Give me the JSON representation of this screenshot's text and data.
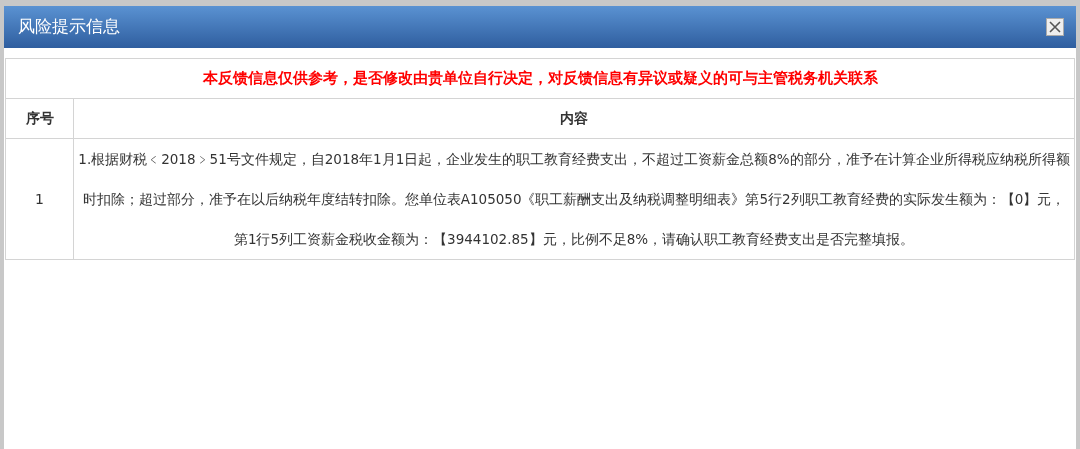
{
  "window": {
    "title": "风险提示信息"
  },
  "notice": "本反馈信息仅供参考，是否修改由贵单位自行决定，对反馈信息有异议或疑义的可与主管税务机关联系",
  "table": {
    "columns": [
      "序号",
      "内容"
    ],
    "rows": [
      {
        "cells": [
          "1",
          "1.根据财税﹤2018﹥51号文件规定，自2018年1月1日起，企业发生的职工教育经费支出，不超过工资薪金总额8%的部分，准予在计算企业所得税应纳税所得额时扣除；超过部分，准予在以后纳税年度结转扣除。您单位表A105050《职工薪酬支出及纳税调整明细表》第5行2列职工教育经费的实际发生额为：【0】元，第1行5列工资薪金税收金额为：【3944102.85】元，比例不足8%，请确认职工教育经费支出是否完整填报。"
        ]
      }
    ]
  }
}
